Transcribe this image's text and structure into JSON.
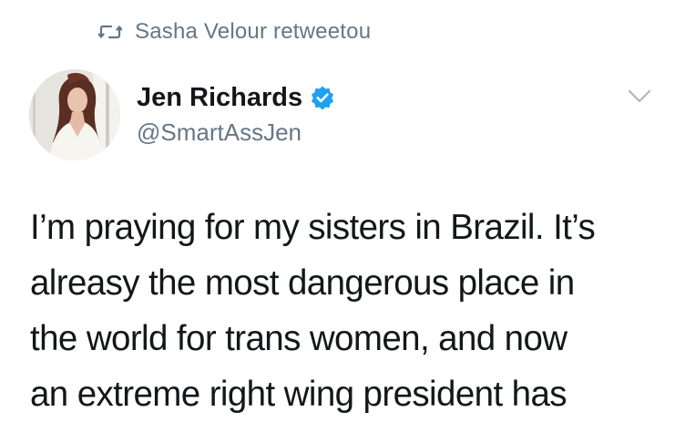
{
  "retweet": {
    "icon": "retweet-icon",
    "text": "Sasha Velour retweetou"
  },
  "author": {
    "avatar": "profile-photo",
    "display_name": "Jen Richards",
    "verified_icon": "verified-badge-icon",
    "handle": "@SmartAssJen"
  },
  "menu": {
    "icon": "chevron-down-icon"
  },
  "tweet": {
    "text": "I’m praying for my sisters in Brazil. It’s\nalreasy the most dangerous place in\nthe world for trans women, and now\nan extreme right wing president has"
  },
  "colors": {
    "secondary_text": "#657786",
    "primary_text": "#14171a",
    "verified_blue": "#1da1f2",
    "caret": "#aab8c2"
  }
}
